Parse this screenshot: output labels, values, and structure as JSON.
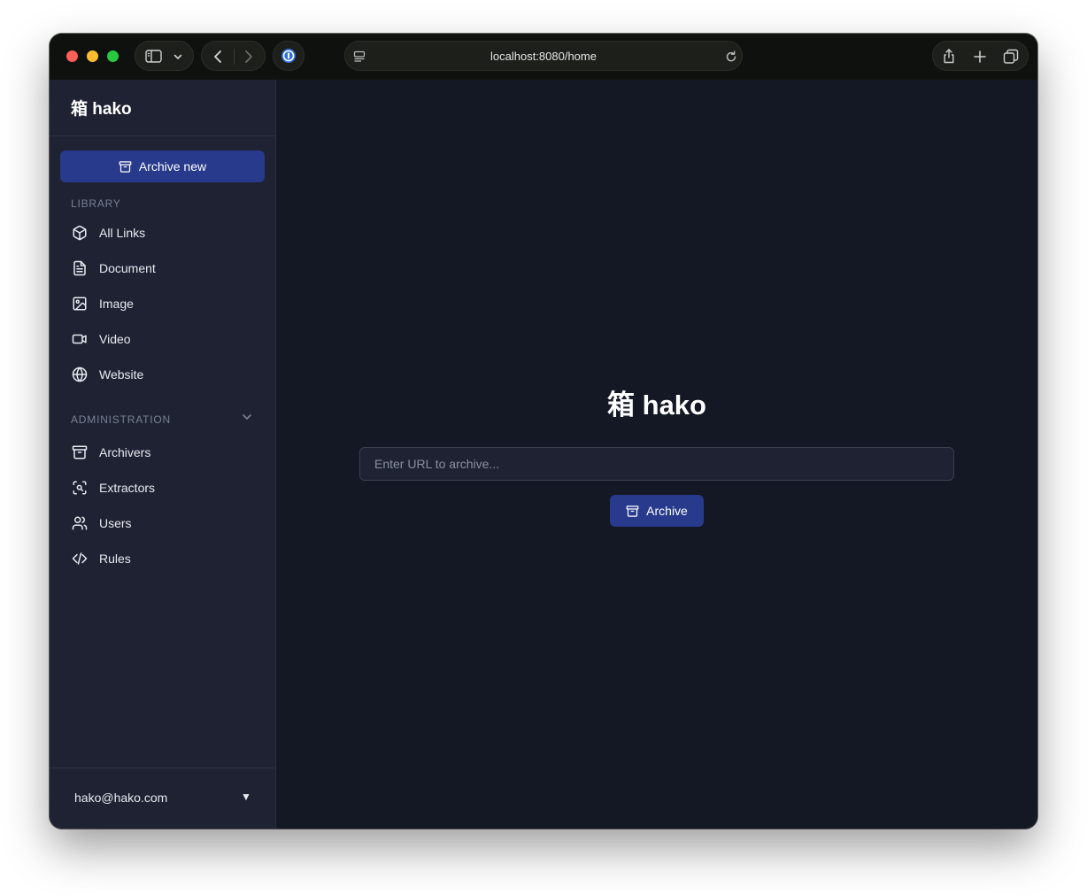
{
  "browser": {
    "url": "localhost:8080/home"
  },
  "sidebar": {
    "brand": "箱 hako",
    "archive_new_label": "Archive new",
    "library_label": "LIBRARY",
    "library_items": [
      {
        "label": "All Links",
        "icon": "cube-icon"
      },
      {
        "label": "Document",
        "icon": "document-icon"
      },
      {
        "label": "Image",
        "icon": "image-icon"
      },
      {
        "label": "Video",
        "icon": "video-icon"
      },
      {
        "label": "Website",
        "icon": "globe-icon"
      }
    ],
    "admin_label": "ADMINISTRATION",
    "admin_items": [
      {
        "label": "Archivers",
        "icon": "archive-icon"
      },
      {
        "label": "Extractors",
        "icon": "scan-icon"
      },
      {
        "label": "Users",
        "icon": "users-icon"
      },
      {
        "label": "Rules",
        "icon": "code-icon"
      }
    ],
    "user_email": "hako@hako.com",
    "user_caret": "▼"
  },
  "main": {
    "title": "箱 hako",
    "url_placeholder": "Enter URL to archive...",
    "url_value": "",
    "archive_button_label": "Archive"
  },
  "colors": {
    "primary": "#283a8c",
    "sidebar_bg": "#1e2232",
    "main_bg": "#141824"
  }
}
